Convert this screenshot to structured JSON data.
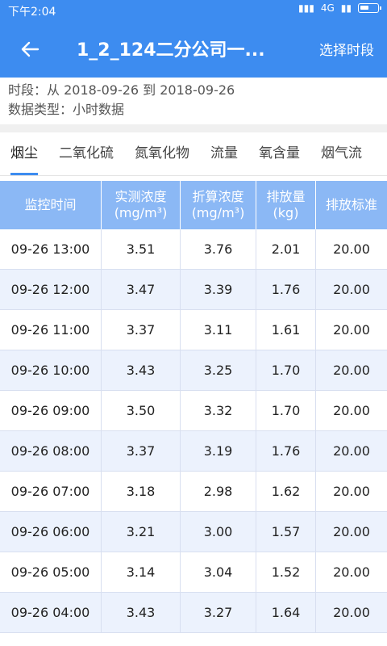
{
  "statusbar": {
    "time": "下午2:04",
    "network": "4G"
  },
  "appbar": {
    "title": "1_2_124二分公司一...",
    "action": "选择时段"
  },
  "info": {
    "period": "时段：从 2018-09-26 到 2018-09-26",
    "datatype": "数据类型：小时数据"
  },
  "tabs": [
    "烟尘",
    "二氧化硫",
    "氮氧化物",
    "流量",
    "氧含量",
    "烟气流"
  ],
  "table": {
    "headers": [
      "监控时间",
      "实测浓度\n(mg/m³)",
      "折算浓度\n(mg/m³)",
      "排放量\n(kg)",
      "排放标准"
    ],
    "rows": [
      [
        "09-26 13:00",
        "3.51",
        "3.76",
        "2.01",
        "20.00"
      ],
      [
        "09-26 12:00",
        "3.47",
        "3.39",
        "1.76",
        "20.00"
      ],
      [
        "09-26 11:00",
        "3.37",
        "3.11",
        "1.61",
        "20.00"
      ],
      [
        "09-26 10:00",
        "3.43",
        "3.25",
        "1.70",
        "20.00"
      ],
      [
        "09-26 09:00",
        "3.50",
        "3.32",
        "1.70",
        "20.00"
      ],
      [
        "09-26 08:00",
        "3.37",
        "3.19",
        "1.76",
        "20.00"
      ],
      [
        "09-26 07:00",
        "3.18",
        "2.98",
        "1.62",
        "20.00"
      ],
      [
        "09-26 06:00",
        "3.21",
        "3.00",
        "1.57",
        "20.00"
      ],
      [
        "09-26 05:00",
        "3.14",
        "3.04",
        "1.52",
        "20.00"
      ],
      [
        "09-26 04:00",
        "3.43",
        "3.27",
        "1.64",
        "20.00"
      ]
    ]
  }
}
